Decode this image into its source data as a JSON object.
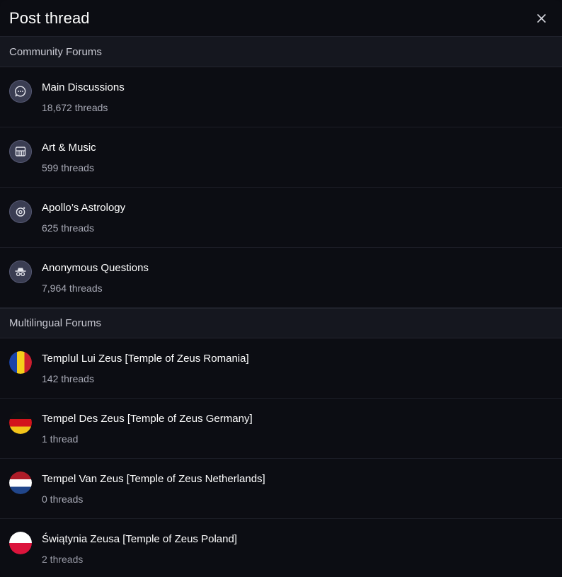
{
  "modal": {
    "title": "Post thread",
    "close_icon": "close-icon"
  },
  "sections": [
    {
      "title": "Community Forums",
      "items": [
        {
          "title": "Main Discussions",
          "count": "18,672 threads",
          "icon": "chat-bubble-icon"
        },
        {
          "title": "Art & Music",
          "count": "599 threads",
          "icon": "piano-icon"
        },
        {
          "title": "Apollo’s Astrology",
          "count": "625 threads",
          "icon": "planet-icon"
        },
        {
          "title": "Anonymous Questions",
          "count": "7,964 threads",
          "icon": "incognito-icon"
        }
      ]
    },
    {
      "title": "Multilingual Forums",
      "items": [
        {
          "title": "Templul Lui Zeus [Temple of Zeus Romania]",
          "count": "142 threads",
          "icon": "romania-flag-icon"
        },
        {
          "title": "Tempel Des Zeus [Temple of Zeus Germany]",
          "count": "1 thread",
          "icon": "germany-flag-icon"
        },
        {
          "title": "Tempel Van Zeus [Temple of Zeus Netherlands]",
          "count": "0 threads",
          "icon": "netherlands-flag-icon"
        },
        {
          "title": "Świątynia Zeusa [Temple of Zeus Poland]",
          "count": "2 threads",
          "icon": "poland-flag-icon"
        }
      ]
    }
  ],
  "colors": {
    "background": "#0c0d13",
    "section_header": "#15171f",
    "icon_circle": "#3a3d52",
    "subtext": "#a7a9b5",
    "romania": [
      "#1a44a8",
      "#f5cf1a",
      "#cc1f2f"
    ],
    "germany": [
      "#111111",
      "#d3141c",
      "#f3c41a"
    ],
    "netherlands": [
      "#ae1c28",
      "#ffffff",
      "#21468b"
    ],
    "poland": [
      "#ffffff",
      "#dc143c"
    ]
  }
}
